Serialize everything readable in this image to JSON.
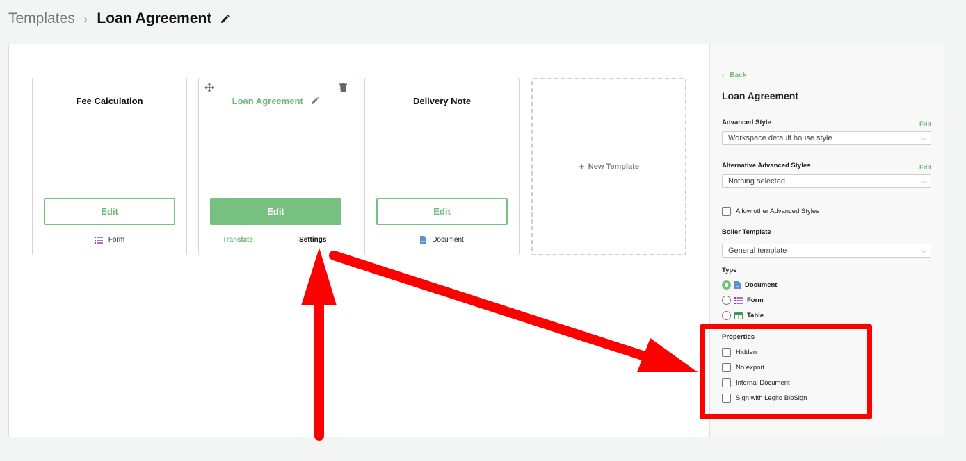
{
  "breadcrumb": {
    "root": "Templates",
    "separator": "›",
    "current": "Loan Agreement"
  },
  "cards": [
    {
      "title": "Fee Calculation",
      "edit_label": "Edit",
      "footer_type": "Form",
      "footer_icon": "list-icon"
    },
    {
      "title": "Loan Agreement",
      "edit_label": "Edit",
      "translate_label": "Translate",
      "settings_label": "Settings",
      "active": true
    },
    {
      "title": "Delivery Note",
      "edit_label": "Edit",
      "footer_type": "Document",
      "footer_icon": "document-icon"
    }
  ],
  "new_template_label": "New Template",
  "sidebar": {
    "back_label": "Back",
    "title": "Loan Agreement",
    "advanced_style": {
      "label": "Advanced Style",
      "edit": "Edit",
      "value": "Workspace default house style"
    },
    "alt_styles": {
      "label": "Alternative Advanced Styles",
      "edit": "Edit",
      "value": "Nothing selected"
    },
    "allow_other": "Allow other Advanced Styles",
    "boiler": {
      "label": "Boiler Template",
      "value": "General template"
    },
    "type": {
      "label": "Type",
      "options": [
        {
          "label": "Document",
          "selected": true,
          "icon": "document-icon"
        },
        {
          "label": "Form",
          "selected": false,
          "icon": "list-icon"
        },
        {
          "label": "Table",
          "selected": false,
          "icon": "table-icon"
        }
      ]
    },
    "properties": {
      "label": "Properties",
      "items": [
        "Hidden",
        "No export",
        "Internal Document",
        "Sign with Legito BioSign"
      ]
    }
  },
  "colors": {
    "accent": "#78c07f",
    "annotation": "#ff0000",
    "form_icon": "#8e3aa8",
    "document_icon": "#5b8fd8",
    "table_icon": "#3a9a5a"
  }
}
